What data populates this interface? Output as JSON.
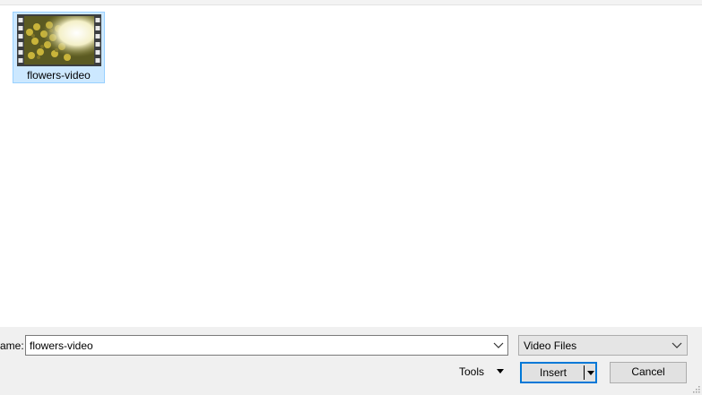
{
  "file_list": {
    "items": [
      {
        "name": "flowers-video",
        "icon": "video-thumbnail-icon",
        "selected": true
      }
    ]
  },
  "footer": {
    "file_name_label": "ame:",
    "file_name_value": "flowers-video",
    "file_type_value": "Video Files",
    "tools_label": "Tools",
    "insert_label": "Insert",
    "cancel_label": "Cancel"
  },
  "colors": {
    "selection_bg": "#cce8ff",
    "selection_border": "#99d1ff",
    "default_button_border": "#0078d7",
    "dialog_bg": "#f0f0f0"
  }
}
